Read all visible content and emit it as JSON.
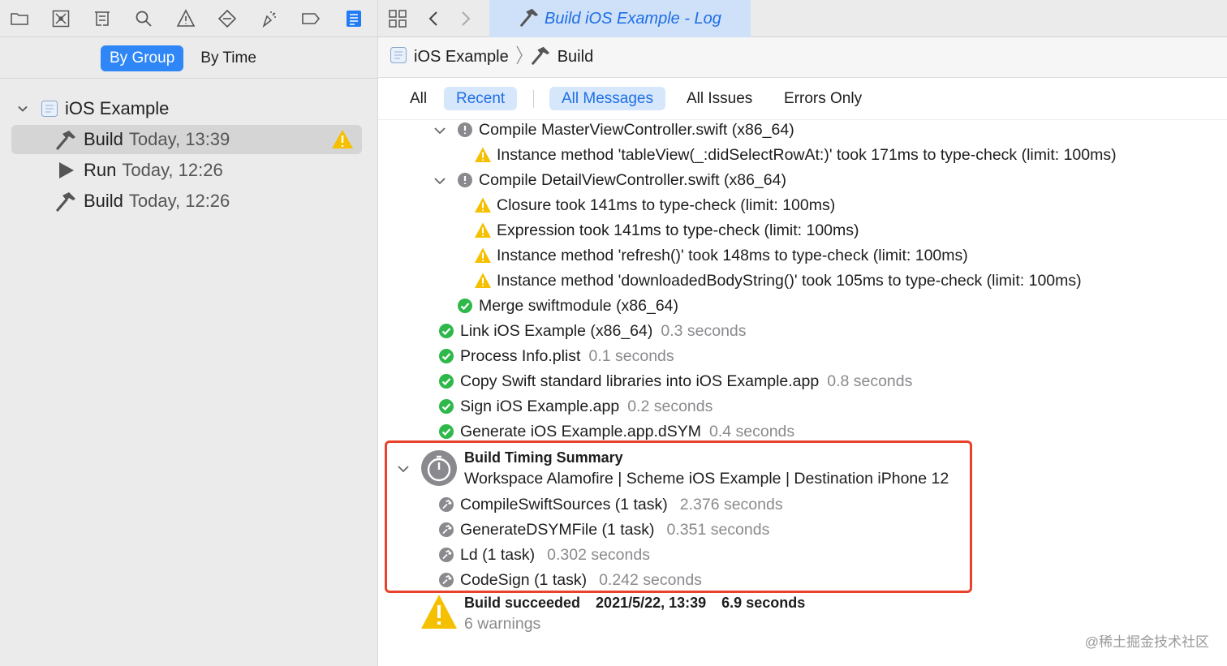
{
  "navigator": {
    "segments": [
      "By Group",
      "By Time"
    ],
    "project": "iOS Example",
    "items": [
      {
        "action": "Build",
        "time": "Today, 13:39",
        "warning": true
      },
      {
        "action": "Run",
        "time": "Today, 12:26"
      },
      {
        "action": "Build",
        "time": "Today, 12:26"
      }
    ]
  },
  "tab": {
    "title": "Build iOS Example - Log"
  },
  "jumpbar": {
    "project": "iOS Example",
    "item": "Build"
  },
  "filters": {
    "scope": [
      "All",
      "Recent"
    ],
    "kind": [
      "All Messages",
      "All Issues",
      "Errors Only"
    ]
  },
  "log": [
    {
      "text": "Compile MasterViewController.swift (x86_64)"
    },
    {
      "text": "Instance method 'tableView(_:didSelectRowAt:)' took 171ms to type-check (limit: 100ms)"
    },
    {
      "text": "Compile DetailViewController.swift (x86_64)"
    },
    {
      "text": "Closure took 141ms to type-check (limit: 100ms)"
    },
    {
      "text": "Expression took 141ms to type-check (limit: 100ms)"
    },
    {
      "text": "Instance method 'refresh()' took 148ms to type-check (limit: 100ms)"
    },
    {
      "text": "Instance method 'downloadedBodyString()' took 105ms to type-check (limit: 100ms)"
    },
    {
      "text": "Merge swiftmodule (x86_64)"
    },
    {
      "text": "Link iOS Example (x86_64)",
      "duration": "0.3 seconds"
    },
    {
      "text": "Process Info.plist",
      "duration": "0.1 seconds"
    },
    {
      "text": "Copy Swift standard libraries into iOS Example.app",
      "duration": "0.8 seconds"
    },
    {
      "text": "Sign iOS Example.app",
      "duration": "0.2 seconds"
    },
    {
      "text": "Generate iOS Example.app.dSYM",
      "duration": "0.4 seconds"
    }
  ],
  "timing_summary": {
    "title": "Build Timing Summary",
    "subtitle": "Workspace Alamofire | Scheme iOS Example | Destination iPhone 12",
    "tasks": [
      {
        "name": "CompileSwiftSources (1 task)",
        "duration": "2.376 seconds"
      },
      {
        "name": "GenerateDSYMFile (1 task)",
        "duration": "0.351 seconds"
      },
      {
        "name": "Ld (1 task)",
        "duration": "0.302 seconds"
      },
      {
        "name": "CodeSign (1 task)",
        "duration": "0.242 seconds"
      }
    ]
  },
  "result": {
    "status": "Build succeeded",
    "date": "2021/5/22, 13:39",
    "duration": "6.9 seconds",
    "warnings": "6 warnings"
  },
  "watermark": "@稀土掘金技术社区",
  "colors": {
    "accent": "#2f86f6",
    "warning": "#f5c000",
    "success": "#2fb84a",
    "highlight": "#e8412c"
  }
}
